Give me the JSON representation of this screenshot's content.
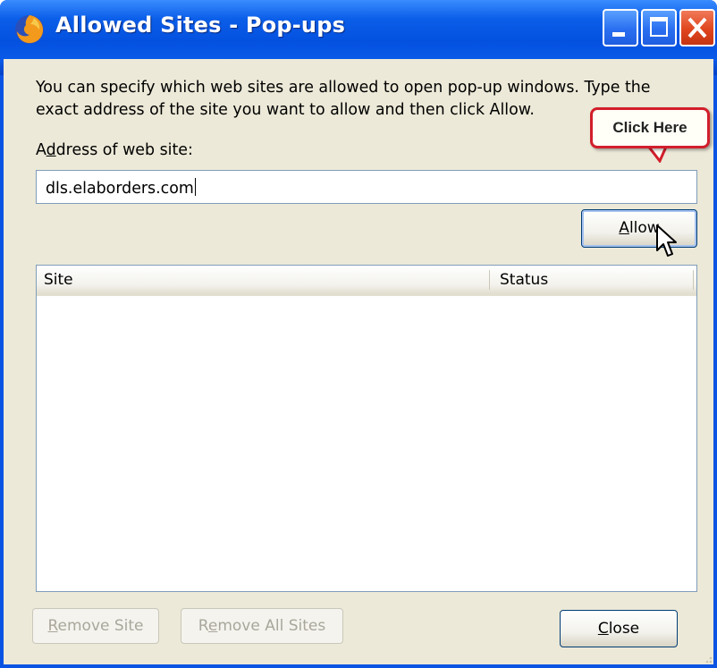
{
  "window": {
    "title": "Allowed Sites - Pop-ups",
    "controls": {
      "minimize": "minimize",
      "maximize": "maximize",
      "close": "close"
    }
  },
  "dialog": {
    "description": "You can specify which web sites are allowed to open pop-up windows. Type the exact address of the site you want to allow and then click Allow.",
    "address_label_prefix": "A",
    "address_label_underlined": "d",
    "address_label_rest": "dress of web site:",
    "address_value": "dls.elaborders.com",
    "allow_button": {
      "underlined": "A",
      "rest": "llow"
    },
    "callout_text": "Click Here",
    "list": {
      "columns": [
        "Site",
        "Status"
      ],
      "rows": []
    },
    "remove_site_button": {
      "underlined": "R",
      "rest": "emove Site"
    },
    "remove_all_button": {
      "prefix": "R",
      "underlined": "e",
      "rest": "move All Sites"
    },
    "close_button": {
      "underlined": "C",
      "rest": "lose"
    }
  },
  "icons": {
    "app": "firefox-icon",
    "cursor": "mouse-pointer-icon"
  },
  "colors": {
    "titlebar": "#0451e0",
    "client_bg": "#ece9d8",
    "callout_border": "#d21f2b"
  }
}
